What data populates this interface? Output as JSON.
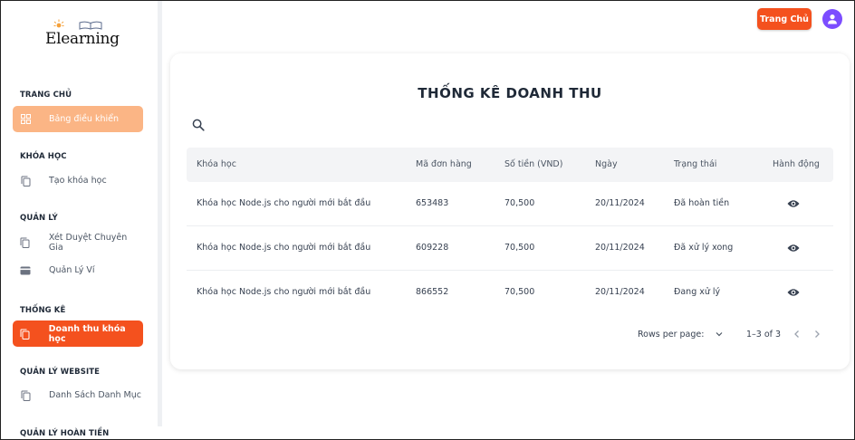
{
  "brand": {
    "logo_text": "Elearning"
  },
  "sidebar": {
    "sections": [
      {
        "title": "TRANG CHỦ"
      },
      {
        "title": "KHÓA HỌC"
      },
      {
        "title": "QUẢN LÝ"
      },
      {
        "title": "THỐNG KÊ"
      },
      {
        "title": "QUẢN LÝ WEBSITE"
      },
      {
        "title": "QUẢN LÝ HOÀN TIỀN"
      }
    ],
    "items": [
      {
        "label": "Bảng điều khiển",
        "icon": "dashboard-icon"
      },
      {
        "label": "Tạo khóa học",
        "icon": "copy-icon"
      },
      {
        "label": "Xét Duyệt Chuyên Gia",
        "icon": "copy-icon"
      },
      {
        "label": "Quản Lý Ví",
        "icon": "wallet-icon"
      },
      {
        "label": "Doanh thu khóa học",
        "icon": "copy-icon"
      },
      {
        "label": "Danh Sách Danh Mục",
        "icon": "copy-icon"
      }
    ]
  },
  "topbar": {
    "home_button": "Trang Chủ",
    "avatar_icon": "user-icon"
  },
  "main": {
    "title": "THỐNG KÊ DOANH THU",
    "search_icon": "search-icon",
    "table": {
      "headers": [
        "Khóa học",
        "Mã đơn hàng",
        "Số tiền (VND)",
        "Ngày",
        "Trạng thái",
        "Hành động"
      ],
      "rows": [
        {
          "course": "Khóa học Node.js cho người mới bắt đầu",
          "order_id": "653483",
          "amount": "70,500",
          "date": "20/11/2024",
          "status": "Đã hoàn tiền",
          "action_icon": "eye-icon"
        },
        {
          "course": "Khóa học Node.js cho người mới bắt đầu",
          "order_id": "609228",
          "amount": "70,500",
          "date": "20/11/2024",
          "status": "Đã xử lý xong",
          "action_icon": "eye-icon"
        },
        {
          "course": "Khóa học Node.js cho người mới bắt đầu",
          "order_id": "866552",
          "amount": "70,500",
          "date": "20/11/2024",
          "status": "Đang xử lý",
          "action_icon": "eye-icon"
        }
      ]
    },
    "pagination": {
      "rows_per_page_label": "Rows per page:",
      "range": "1–3 of 3"
    }
  },
  "colors": {
    "accent": "#f4511e",
    "accent_soft": "#fbb585",
    "avatar": "#7c4dff"
  }
}
